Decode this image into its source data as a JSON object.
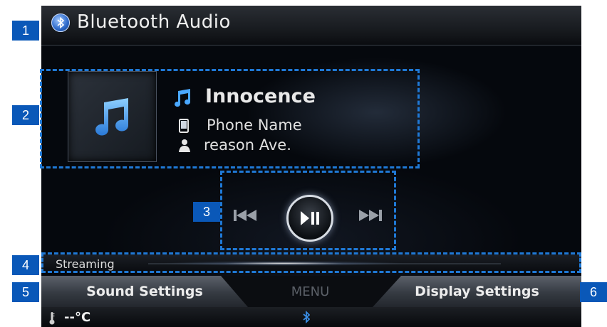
{
  "header": {
    "title": "Bluetooth Audio",
    "icon": "bluetooth-icon"
  },
  "track": {
    "title": "Innocence",
    "device": "Phone Name",
    "artist": "reason Ave.",
    "icons": {
      "title": "music-note-icon",
      "device": "phone-icon",
      "artist": "person-icon"
    }
  },
  "controls": {
    "prev": "previous-track-icon",
    "play_pause": "play-pause-icon",
    "next": "next-track-icon"
  },
  "status": {
    "label": "Streaming"
  },
  "softkeys": {
    "left": "Sound Settings",
    "center": "MENU",
    "right": "Display Settings"
  },
  "footer": {
    "temperature": "--°C"
  },
  "callouts": [
    "1",
    "2",
    "3",
    "4",
    "5",
    "6"
  ],
  "colors": {
    "callout": "#0a58b8",
    "highlight_dash": "#1f79d6",
    "accent_blue": "#3a8ee6"
  }
}
